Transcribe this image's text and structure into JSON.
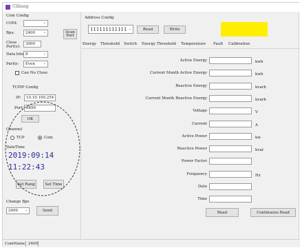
{
  "window": {
    "title": "Clibang"
  },
  "com_config": {
    "title": "Com Config",
    "com_label": "COM:",
    "com_value": "",
    "bps_label": "Bps:",
    "bps_value": "2400",
    "scan_port_label": "Scan Port",
    "close_port_label": "Close Port(s):",
    "close_port_value": "3000",
    "data_bits_label": "Data bits:",
    "data_bits_value": "8",
    "parity_label": "Parity:",
    "parity_value": "Even",
    "can_no_close_label": "Can No Close"
  },
  "tcpip_config": {
    "title": "TCPIP Config",
    "ip_label": "IP:",
    "ip_value": "10.10.100.254",
    "port_label": "Port:",
    "port_value": "8899",
    "ok_label": "OK"
  },
  "channel": {
    "title": "Channel",
    "tcp_label": "TCP",
    "com_label": "Com",
    "selected": "Com"
  },
  "datetime": {
    "label": "DateTime",
    "date": "2019:09:14",
    "time": "11:22:43"
  },
  "set_buttons": {
    "set_rang_label": "Set Rang",
    "set_time_label": "Set Time"
  },
  "change_bps": {
    "title": "Change Bps",
    "value": "2400",
    "send_label": "Send"
  },
  "address_config": {
    "title": "Address Config",
    "value": "111111111111",
    "read_label": "Read",
    "write_label": "Write",
    "highlight_color": "#ffee00"
  },
  "tabs": [
    "Energy",
    "Threshold",
    "Switch",
    "Energy Threshold",
    "Temperature",
    "Fault",
    "Calibration"
  ],
  "energy_rows": [
    {
      "label": "Active Energy",
      "unit": "kwh"
    },
    {
      "label": "Current Month Active Energy",
      "unit": "kwh"
    },
    {
      "label": "Reactive Energy",
      "unit": "kvarh"
    },
    {
      "label": "Current Month Reactive Energy",
      "unit": "kvarh"
    },
    {
      "label": "Voltage",
      "unit": "V"
    },
    {
      "label": "Current",
      "unit": "A"
    },
    {
      "label": "Active Power",
      "unit": "kw"
    },
    {
      "label": "Reactive Power",
      "unit": "kvar"
    },
    {
      "label": "Power Factor",
      "unit": ""
    },
    {
      "label": "Frequency",
      "unit": "Hz"
    },
    {
      "label": "Date",
      "unit": ""
    },
    {
      "label": "Time",
      "unit": ""
    }
  ],
  "bottom_buttons": {
    "read_label": "Read",
    "continuous_read_label": "Continuous Read"
  },
  "status": {
    "com_name": "ComName",
    "bps": "2400"
  }
}
